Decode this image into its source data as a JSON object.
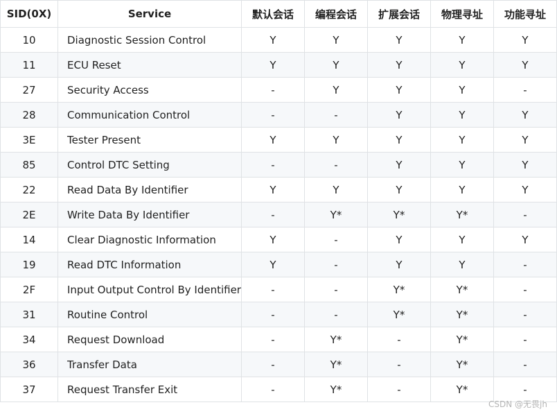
{
  "table": {
    "headers": [
      "SID(0X)",
      "Service",
      "默认会话",
      "编程会话",
      "扩展会话",
      "物理寻址",
      "功能寻址"
    ],
    "rows": [
      [
        "10",
        "Diagnostic Session Control",
        "Y",
        "Y",
        "Y",
        "Y",
        "Y"
      ],
      [
        "11",
        "ECU Reset",
        "Y",
        "Y",
        "Y",
        "Y",
        "Y"
      ],
      [
        "27",
        "Security Access",
        "-",
        "Y",
        "Y",
        "Y",
        "-"
      ],
      [
        "28",
        "Communication Control",
        "-",
        "-",
        "Y",
        "Y",
        "Y"
      ],
      [
        "3E",
        "Tester Present",
        "Y",
        "Y",
        "Y",
        "Y",
        "Y"
      ],
      [
        "85",
        "Control DTC Setting",
        "-",
        "-",
        "Y",
        "Y",
        "Y"
      ],
      [
        "22",
        "Read Data By Identifier",
        "Y",
        "Y",
        "Y",
        "Y",
        "Y"
      ],
      [
        "2E",
        "Write Data By Identifier",
        "-",
        "Y*",
        "Y*",
        "Y*",
        "-"
      ],
      [
        "14",
        "Clear Diagnostic Information",
        "Y",
        "-",
        "Y",
        "Y",
        "Y"
      ],
      [
        "19",
        "Read DTC Information",
        "Y",
        "-",
        "Y",
        "Y",
        "-"
      ],
      [
        "2F",
        "Input Output Control By Identifier",
        "-",
        "-",
        "Y*",
        "Y*",
        "-"
      ],
      [
        "31",
        "Routine Control",
        "-",
        "-",
        "Y*",
        "Y*",
        "-"
      ],
      [
        "34",
        "Request Download",
        "-",
        "Y*",
        "-",
        "Y*",
        "-"
      ],
      [
        "36",
        "Transfer Data",
        "-",
        "Y*",
        "-",
        "Y*",
        "-"
      ],
      [
        "37",
        "Request Transfer Exit",
        "-",
        "Y*",
        "-",
        "Y*",
        "-"
      ]
    ]
  },
  "watermark": "CSDN @无畏jh"
}
